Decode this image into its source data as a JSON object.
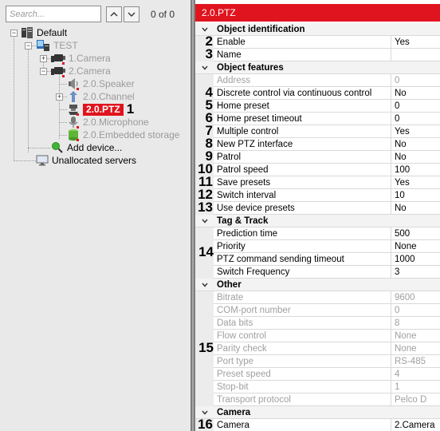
{
  "search": {
    "placeholder": "Search...",
    "count": "0 of 0"
  },
  "tree": {
    "root": "Default",
    "server": "TEST",
    "camera1": "1.Camera",
    "camera2": "2.Camera",
    "speaker": "2.0.Speaker",
    "channel": "2.0.Channel",
    "ptz": "2.0.PTZ",
    "microphone": "2.0.Microphone",
    "storage": "2.0.Embedded storage",
    "add_device": "Add device...",
    "unallocated": "Unallocated servers",
    "ptz_marker": "1"
  },
  "panel_title": "2.0.PTZ",
  "sections": [
    {
      "title": "Object identification",
      "rows": [
        {
          "num": "2",
          "name": "Enable",
          "value": "Yes",
          "disabled": false
        },
        {
          "num": "3",
          "name": "Name",
          "value": "",
          "disabled": false
        }
      ]
    },
    {
      "title": "Object features",
      "rows": [
        {
          "num": "",
          "name": "Address",
          "value": "0",
          "disabled": true
        },
        {
          "num": "4",
          "name": "Discrete control via continuous control",
          "value": "No",
          "disabled": false
        },
        {
          "num": "5",
          "name": "Home preset",
          "value": "0",
          "disabled": false
        },
        {
          "num": "6",
          "name": "Home preset timeout",
          "value": "0",
          "disabled": false
        },
        {
          "num": "7",
          "name": "Multiple control",
          "value": "Yes",
          "disabled": false
        },
        {
          "num": "8",
          "name": "New PTZ interface",
          "value": "No",
          "disabled": false
        },
        {
          "num": "9",
          "name": "Patrol",
          "value": "No",
          "disabled": false
        },
        {
          "num": "10",
          "name": "Patrol speed",
          "value": "100",
          "disabled": false
        },
        {
          "num": "11",
          "name": "Save presets",
          "value": "Yes",
          "disabled": false
        },
        {
          "num": "12",
          "name": "Switch interval",
          "value": "10",
          "disabled": false
        },
        {
          "num": "13",
          "name": "Use device presets",
          "value": "No",
          "disabled": false
        }
      ]
    },
    {
      "title": "Tag & Track",
      "group_num": "14",
      "rows": [
        {
          "num": "",
          "name": "Prediction time",
          "value": "500",
          "disabled": false
        },
        {
          "num": "",
          "name": "Priority",
          "value": "None",
          "disabled": false
        },
        {
          "num": "",
          "name": "PTZ command sending timeout",
          "value": "1000",
          "disabled": false
        },
        {
          "num": "",
          "name": "Switch Frequency",
          "value": "3",
          "disabled": false
        }
      ]
    },
    {
      "title": "Other",
      "group_num": "15",
      "rows": [
        {
          "num": "",
          "name": "Bitrate",
          "value": "9600",
          "disabled": true
        },
        {
          "num": "",
          "name": "COM-port number",
          "value": "0",
          "disabled": true
        },
        {
          "num": "",
          "name": "Data bits",
          "value": "8",
          "disabled": true
        },
        {
          "num": "",
          "name": "Flow control",
          "value": "None",
          "disabled": true
        },
        {
          "num": "",
          "name": "Parity check",
          "value": "None",
          "disabled": true
        },
        {
          "num": "",
          "name": "Port type",
          "value": "RS-485",
          "disabled": true
        },
        {
          "num": "",
          "name": "Preset speed",
          "value": "4",
          "disabled": true
        },
        {
          "num": "",
          "name": "Stop-bit",
          "value": "1",
          "disabled": true
        },
        {
          "num": "",
          "name": "Transport protocol",
          "value": "Pelco D",
          "disabled": true
        }
      ]
    },
    {
      "title": "Camera",
      "rows": [
        {
          "num": "16",
          "name": "Camera",
          "value": "2.Camera",
          "disabled": false
        }
      ]
    }
  ],
  "colors": {
    "accent": "#e0141e",
    "disabled_text": "#a0a0a0",
    "pane_bg": "#e9e9e9"
  },
  "icons": [
    "search-up-icon",
    "search-down-icon",
    "server-group-icon",
    "server-icon",
    "camera-icon",
    "speaker-icon",
    "channel-icon",
    "ptz-icon",
    "microphone-icon",
    "storage-icon",
    "add-device-icon",
    "monitor-icon",
    "chevron-down-icon"
  ]
}
